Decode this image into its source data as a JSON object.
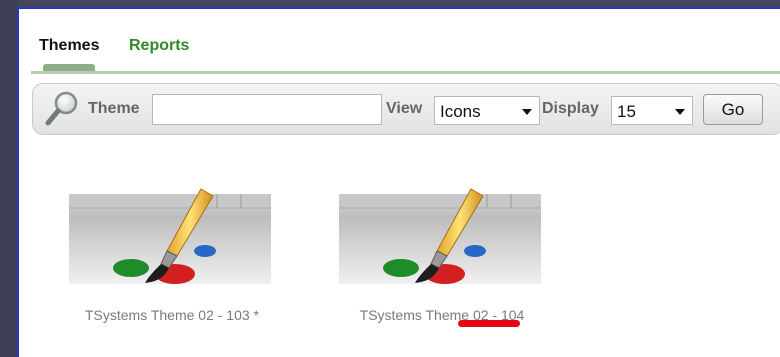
{
  "tabs": [
    {
      "label": "Themes",
      "active": true
    },
    {
      "label": "Reports",
      "active": false
    }
  ],
  "search": {
    "theme_label": "Theme",
    "theme_value": "",
    "view_label": "View",
    "view_value": "Icons",
    "display_label": "Display",
    "display_value": "15",
    "go_label": "Go"
  },
  "themes": [
    {
      "caption": "TSystems Theme 02 - 103 *"
    },
    {
      "caption": "TSystems Theme 02 - 104"
    }
  ],
  "colors": {
    "accent_green": "#2f8a2a",
    "highlight_red": "#e30613",
    "panel_border": "#2a34c8"
  }
}
